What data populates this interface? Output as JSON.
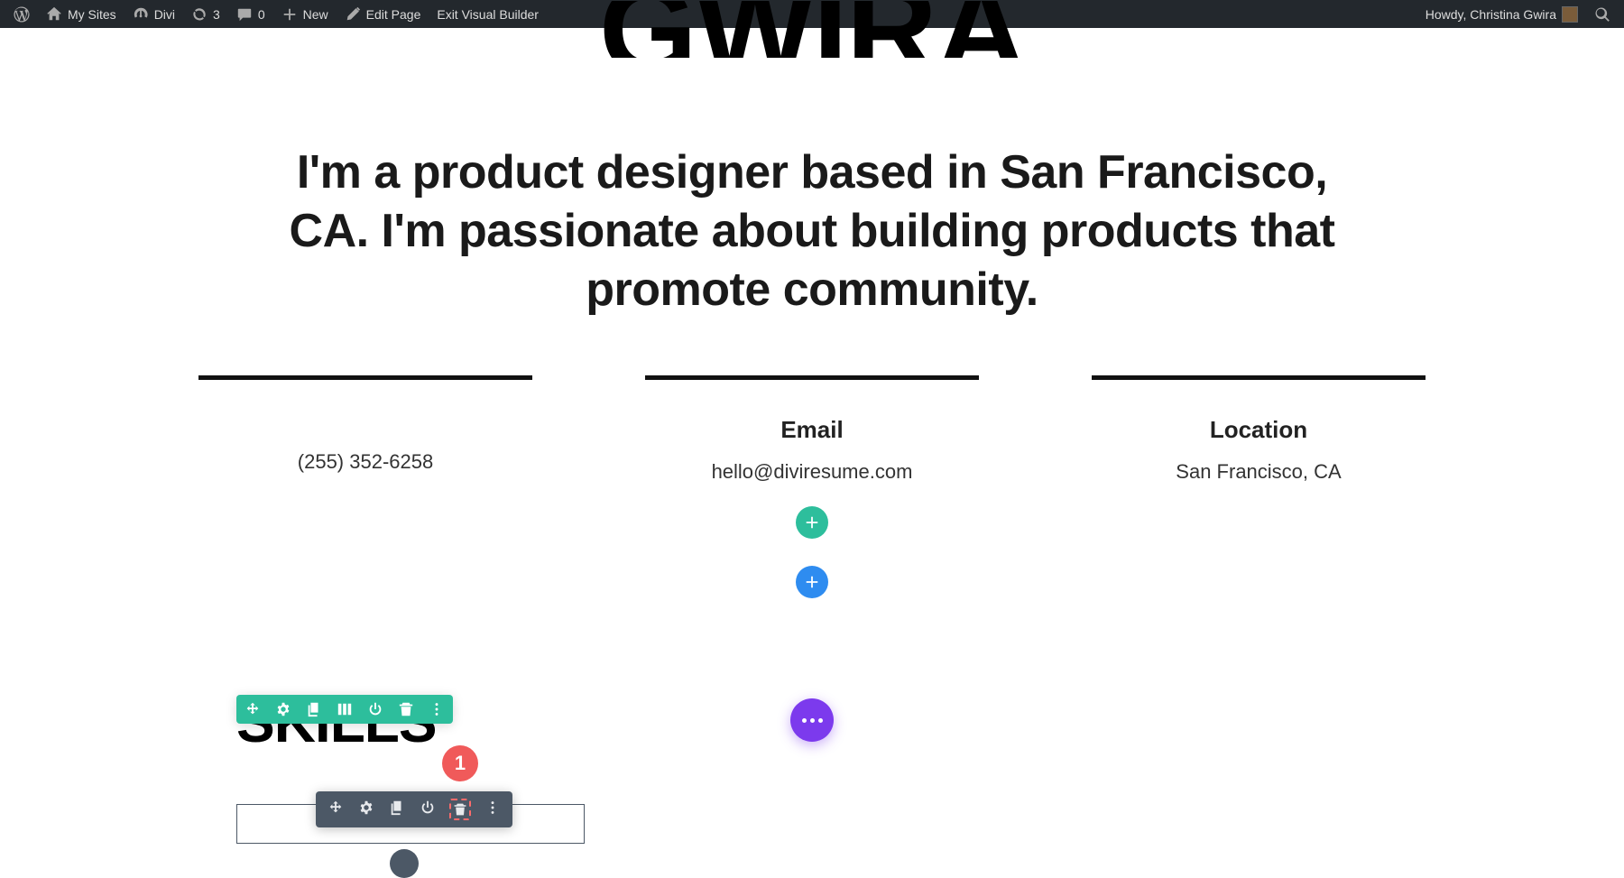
{
  "adminbar": {
    "my_sites": "My Sites",
    "divi": "Divi",
    "updates_count": "3",
    "comments_count": "0",
    "new": "New",
    "edit_page": "Edit Page",
    "exit_vb": "Exit Visual Builder",
    "howdy": "Howdy, Christina Gwira"
  },
  "hero": {
    "title_partial": "GWIRA",
    "intro": "I'm a product designer based in San Francisco, CA. I'm passionate about building products that promote community."
  },
  "annotation": {
    "number": "1"
  },
  "contact": {
    "phone_label": "",
    "phone_value": "(255) 352-6258",
    "email_label": "Email",
    "email_value": "hello@diviresume.com",
    "location_label": "Location",
    "location_value": "San Francisco, CA"
  },
  "skills": {
    "heading": "SKILLS"
  },
  "row_toolbar": {
    "items": [
      "move",
      "settings",
      "duplicate",
      "columns",
      "power",
      "delete",
      "more"
    ]
  },
  "module_toolbar": {
    "items": [
      "move",
      "settings",
      "duplicate",
      "power",
      "delete",
      "more"
    ]
  }
}
